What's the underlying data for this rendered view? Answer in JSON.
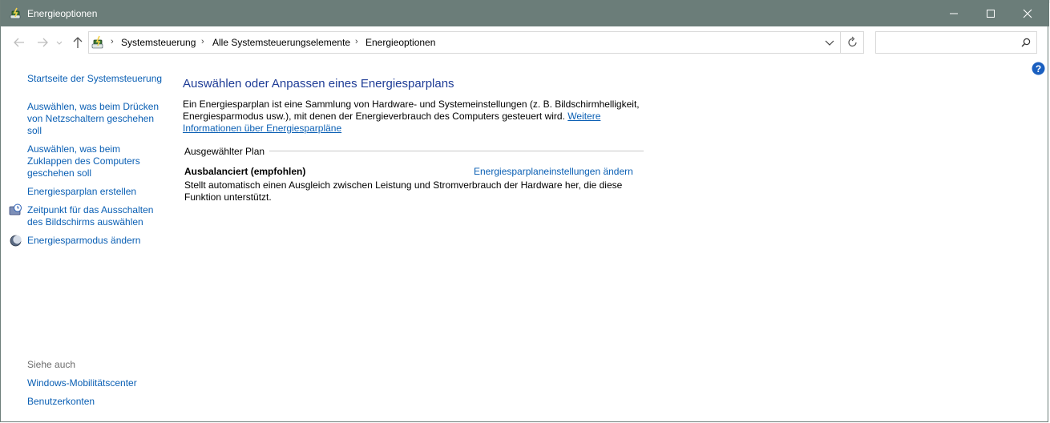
{
  "window": {
    "title": "Energieoptionen",
    "minimize_icon": "minimize-icon",
    "maximize_icon": "maximize-icon",
    "close_icon": "close-icon"
  },
  "address": {
    "breadcrumbs": [
      "Systemsteuerung",
      "Alle Systemsteuerungselemente",
      "Energieoptionen"
    ],
    "search_placeholder": ""
  },
  "sidebar": {
    "home_link": "Startseite der Systemsteuerung",
    "items": [
      {
        "label": "Auswählen, was beim Drücken von Netzschaltern geschehen soll"
      },
      {
        "label": "Auswählen, was beim Zuklappen des Computers geschehen soll"
      },
      {
        "label": "Energiesparplan erstellen"
      },
      {
        "label": "Zeitpunkt für das Ausschalten des Bildschirms auswählen",
        "icon": "clock-monitor-icon"
      },
      {
        "label": "Energiesparmodus ändern",
        "icon": "moon-icon"
      }
    ],
    "see_also_heading": "Siehe auch",
    "see_also": [
      "Windows-Mobilitätscenter",
      "Benutzerkonten"
    ]
  },
  "main": {
    "title": "Auswählen oder Anpassen eines Energiesparplans",
    "description": "Ein Energiesparplan ist eine Sammlung von Hardware- und Systemeinstellungen (z. B. Bildschirmhelligkeit, Energiesparmodus usw.), mit denen der Energieverbrauch des Computers gesteuert wird. ",
    "more_info_link": "Weitere Informationen über Energiesparpläne",
    "section_label": "Ausgewählter Plan",
    "plan_name": "Ausbalanciert (empfohlen)",
    "plan_settings_link": "Energiesparplaneinstellungen ändern",
    "plan_description": "Stellt automatisch einen Ausgleich zwischen Leistung und Stromverbrauch der Hardware her, die diese Funktion unterstützt."
  },
  "colors": {
    "titlebar": "#6b7d79",
    "link": "#0a5fb4",
    "heading": "#1e3c96"
  }
}
